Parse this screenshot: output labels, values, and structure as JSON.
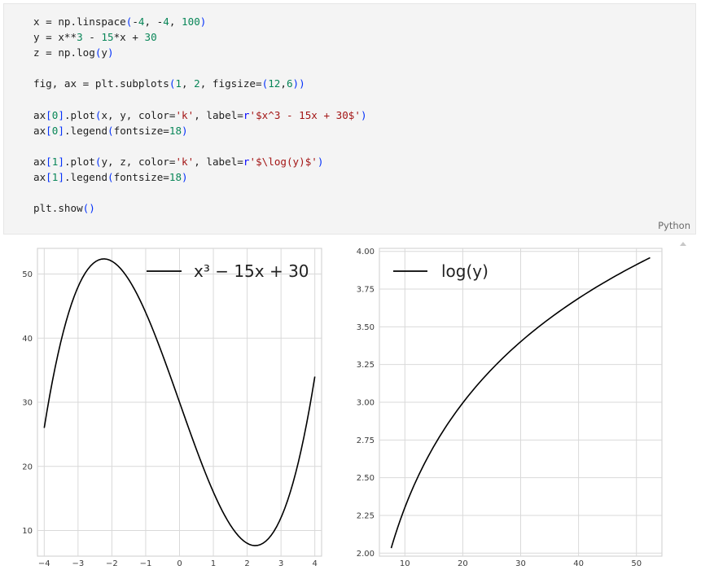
{
  "code_cell": {
    "language_label": "Python",
    "lines": [
      [
        {
          "t": "x = np.linspace"
        },
        {
          "t": "(",
          "c": "par"
        },
        {
          "t": "-"
        },
        {
          "t": "4",
          "c": "num"
        },
        {
          "t": ", -"
        },
        {
          "t": "4",
          "c": "num"
        },
        {
          "t": ", "
        },
        {
          "t": "100",
          "c": "num"
        },
        {
          "t": ")",
          "c": "par"
        }
      ],
      [
        {
          "t": "y = x**"
        },
        {
          "t": "3",
          "c": "num"
        },
        {
          "t": " - "
        },
        {
          "t": "15",
          "c": "num"
        },
        {
          "t": "*x + "
        },
        {
          "t": "30",
          "c": "num"
        }
      ],
      [
        {
          "t": "z = np.log"
        },
        {
          "t": "(",
          "c": "par"
        },
        {
          "t": "y"
        },
        {
          "t": ")",
          "c": "par"
        }
      ],
      [],
      [
        {
          "t": "fig, ax = plt.subplots"
        },
        {
          "t": "(",
          "c": "par"
        },
        {
          "t": "1",
          "c": "num"
        },
        {
          "t": ", "
        },
        {
          "t": "2",
          "c": "num"
        },
        {
          "t": ", figsize="
        },
        {
          "t": "(",
          "c": "par"
        },
        {
          "t": "12",
          "c": "num"
        },
        {
          "t": ","
        },
        {
          "t": "6",
          "c": "num"
        },
        {
          "t": "))",
          "c": "par"
        }
      ],
      [],
      [
        {
          "t": "ax"
        },
        {
          "t": "[",
          "c": "par"
        },
        {
          "t": "0",
          "c": "num"
        },
        {
          "t": "]",
          "c": "par"
        },
        {
          "t": ".plot"
        },
        {
          "t": "(",
          "c": "par"
        },
        {
          "t": "x, y, color="
        },
        {
          "t": "'k'",
          "c": "str"
        },
        {
          "t": ", label="
        },
        {
          "t": "r",
          "c": "kw"
        },
        {
          "t": "'$x^3 - 15x + 30$'",
          "c": "str"
        },
        {
          "t": ")",
          "c": "par"
        }
      ],
      [
        {
          "t": "ax"
        },
        {
          "t": "[",
          "c": "par"
        },
        {
          "t": "0",
          "c": "num"
        },
        {
          "t": "]",
          "c": "par"
        },
        {
          "t": ".legend"
        },
        {
          "t": "(",
          "c": "par"
        },
        {
          "t": "fontsize="
        },
        {
          "t": "18",
          "c": "num"
        },
        {
          "t": ")",
          "c": "par"
        }
      ],
      [],
      [
        {
          "t": "ax"
        },
        {
          "t": "[",
          "c": "par"
        },
        {
          "t": "1",
          "c": "num"
        },
        {
          "t": "]",
          "c": "par"
        },
        {
          "t": ".plot"
        },
        {
          "t": "(",
          "c": "par"
        },
        {
          "t": "y, z, color="
        },
        {
          "t": "'k'",
          "c": "str"
        },
        {
          "t": ", label="
        },
        {
          "t": "r",
          "c": "kw"
        },
        {
          "t": "'$\\log(y)$'",
          "c": "str"
        },
        {
          "t": ")",
          "c": "par"
        }
      ],
      [
        {
          "t": "ax"
        },
        {
          "t": "[",
          "c": "par"
        },
        {
          "t": "1",
          "c": "num"
        },
        {
          "t": "]",
          "c": "par"
        },
        {
          "t": ".legend"
        },
        {
          "t": "(",
          "c": "par"
        },
        {
          "t": "fontsize="
        },
        {
          "t": "18",
          "c": "num"
        },
        {
          "t": ")",
          "c": "par"
        }
      ],
      [],
      [
        {
          "t": "plt.show"
        },
        {
          "t": "()",
          "c": "par"
        }
      ]
    ]
  },
  "chart_data": [
    {
      "type": "line",
      "series": [
        {
          "name": "x³ − 15x + 30",
          "function": "x^3 - 15x + 30",
          "color": "#000000"
        }
      ],
      "xlim": [
        -4.2,
        4.2
      ],
      "ylim": [
        6,
        54
      ],
      "xticks": [
        -4,
        -3,
        -2,
        -1,
        0,
        1,
        2,
        3,
        4
      ],
      "xtick_labels": [
        "−4",
        "−3",
        "−2",
        "−1",
        "0",
        "1",
        "2",
        "3",
        "4"
      ],
      "yticks": [
        10,
        20,
        30,
        40,
        50
      ],
      "ytick_labels": [
        "10",
        "20",
        "30",
        "40",
        "50"
      ],
      "grid": true,
      "legend": "top-right",
      "title": "",
      "xlabel": "",
      "ylabel": ""
    },
    {
      "type": "line",
      "series": [
        {
          "name": "log(y)",
          "function": "ln(y), y = x^3 - 15x + 30, x in [-4, 4]",
          "color": "#000000"
        }
      ],
      "xlim": [
        5.6,
        54.4
      ],
      "ylim": [
        1.98,
        4.02
      ],
      "xticks": [
        10,
        20,
        30,
        40,
        50
      ],
      "xtick_labels": [
        "10",
        "20",
        "30",
        "40",
        "50"
      ],
      "yticks": [
        2.0,
        2.25,
        2.5,
        2.75,
        3.0,
        3.25,
        3.5,
        3.75,
        4.0
      ],
      "ytick_labels": [
        "2.00",
        "2.25",
        "2.50",
        "2.75",
        "3.00",
        "3.25",
        "3.50",
        "3.75",
        "4.00"
      ],
      "grid": true,
      "legend": "top-left",
      "title": "",
      "xlabel": "",
      "ylabel": ""
    }
  ],
  "colors": {
    "cell_bg": "#f4f4f4",
    "grid": "#d9d9d9",
    "axes_edge": "#cccccc",
    "tick_text": "#3a3a3a"
  }
}
